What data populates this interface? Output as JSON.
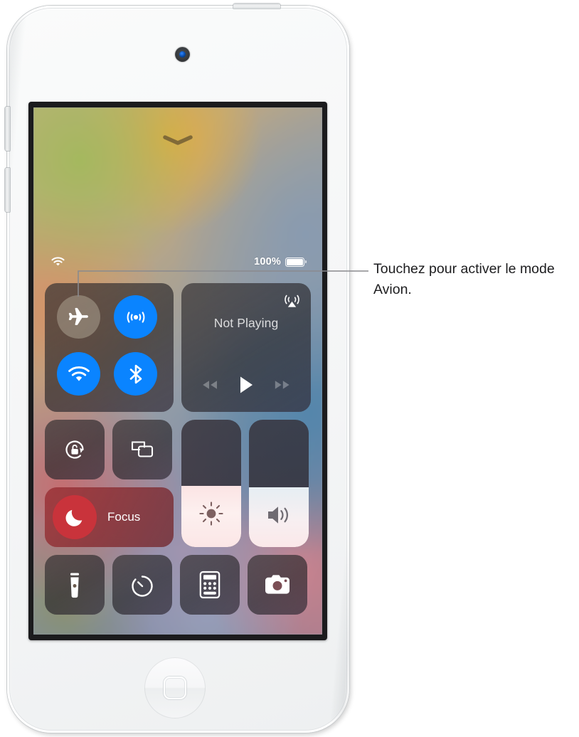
{
  "callout": {
    "text": "Touchez pour activer le mode Avion."
  },
  "device": {
    "camera_icon": "front-camera",
    "home_button_icon": "home-button",
    "volume_up_icon": "volume-up-button",
    "volume_down_icon": "volume-down-button",
    "power_icon": "power-button"
  },
  "screen": {
    "grabber_icon": "chevron-down-grabber",
    "status_bar": {
      "wifi_icon": "wifi-icon",
      "battery_percent": "100%",
      "battery_icon": "battery-full-icon",
      "battery_level": 100
    },
    "control_center": {
      "connectivity": {
        "airplane": {
          "label": "Airplane Mode",
          "icon": "airplane-icon",
          "state": "off"
        },
        "airdrop": {
          "label": "AirDrop",
          "icon": "airdrop-icon",
          "state": "on"
        },
        "wifi": {
          "label": "Wi-Fi",
          "icon": "wifi-icon",
          "state": "on"
        },
        "bluetooth": {
          "label": "Bluetooth",
          "icon": "bluetooth-icon",
          "state": "on"
        }
      },
      "now_playing": {
        "title": "Not Playing",
        "airplay_icon": "airplay-audio-icon",
        "rewind_icon": "rewind-icon",
        "play_icon": "play-icon",
        "forward_icon": "fast-forward-icon"
      },
      "rotation_lock": {
        "label": "Rotation Lock",
        "icon": "rotation-lock-icon"
      },
      "screen_mirroring": {
        "label": "Screen Mirroring",
        "icon": "screen-mirroring-icon"
      },
      "focus": {
        "label": "Focus",
        "icon": "moon-icon",
        "state": "on"
      },
      "brightness": {
        "label": "Brightness",
        "icon": "brightness-icon",
        "value": 48
      },
      "volume": {
        "label": "Volume",
        "icon": "speaker-icon",
        "value": 47
      },
      "flashlight": {
        "label": "Flashlight",
        "icon": "flashlight-icon"
      },
      "timer": {
        "label": "Timer",
        "icon": "timer-icon"
      },
      "calculator": {
        "label": "Calculator",
        "icon": "calculator-icon"
      },
      "camera": {
        "label": "Camera",
        "icon": "camera-icon"
      }
    }
  },
  "colors": {
    "accent_blue": "#0a84ff",
    "focus_red": "#c9333b",
    "off_gray": "#b9b0a0",
    "callout_line": "#8a8a8e",
    "text": "#1d1d1f"
  }
}
